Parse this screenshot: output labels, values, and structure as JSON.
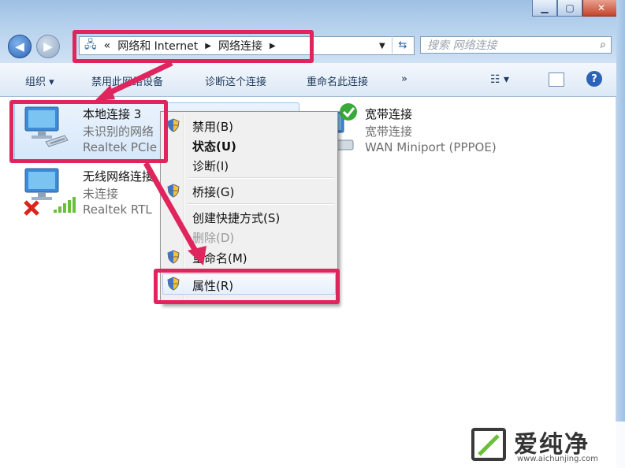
{
  "address": {
    "chevron": "«",
    "crumbs": [
      "网络和 Internet",
      "网络连接"
    ],
    "search_placeholder": "搜索 网络连接"
  },
  "toolbar": {
    "organize": "组织 ▾",
    "disable": "禁用此网络设备",
    "diagnose": "诊断这个连接",
    "rename": "重命名此连接",
    "more": "»"
  },
  "connections": [
    {
      "name": "本地连接 3",
      "status": "未识别的网络",
      "adapter": "Realtek PCIe"
    },
    {
      "name": "无线网络连接",
      "status": "未连接",
      "adapter": "Realtek RTL"
    },
    {
      "name": "宽带连接",
      "status": "宽带连接",
      "adapter": "WAN Miniport (PPPOE)"
    }
  ],
  "context_menu": [
    {
      "label": "禁用(B)",
      "shield": true
    },
    {
      "label": "状态(U)",
      "bold": true
    },
    {
      "label": "诊断(I)"
    },
    {
      "label": "桥接(G)",
      "shield": true
    },
    {
      "label": "创建快捷方式(S)"
    },
    {
      "label": "删除(D)",
      "disabled": true
    },
    {
      "label": "重命名(M)",
      "shield": true
    },
    {
      "label": "属性(R)",
      "shield": true
    }
  ],
  "watermark": {
    "title": "爱纯净",
    "url": "www.aichunjing.com"
  },
  "colors": {
    "highlight_box": "#e0245e",
    "accent": "#2c64b4"
  },
  "icons": {
    "back": "back-arrow-icon",
    "forward": "forward-arrow-icon",
    "refresh": "refresh-icon",
    "search": "search-icon",
    "shield": "uac-shield-icon",
    "help": "help-icon"
  }
}
